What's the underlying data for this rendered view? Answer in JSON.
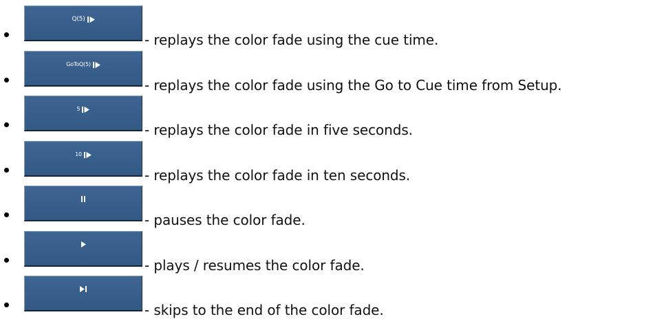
{
  "items": [
    {
      "button_label": "Q(5)",
      "button_icon": "replay-icon",
      "description": "- replays the color fade using the cue time."
    },
    {
      "button_label": "GoToQ(5)",
      "button_icon": "replay-icon",
      "description": "- replays the color fade using the Go to Cue time from Setup."
    },
    {
      "button_label": "5",
      "button_icon": "replay-icon",
      "description": "- replays the color fade in five seconds."
    },
    {
      "button_label": "10",
      "button_icon": "replay-icon",
      "description": "- replays the color fade in ten seconds."
    },
    {
      "button_label": "",
      "button_icon": "pause-icon",
      "description": "- pauses the color fade."
    },
    {
      "button_label": "",
      "button_icon": "play-icon",
      "description": "- plays / resumes the color fade."
    },
    {
      "button_label": "",
      "button_icon": "skip-to-end-icon",
      "description": "- skips to the end of the color fade."
    }
  ],
  "colors": {
    "button_fill": "#39608c",
    "button_text": "#ffffff",
    "text": "#111111",
    "bullet": "#000000"
  }
}
